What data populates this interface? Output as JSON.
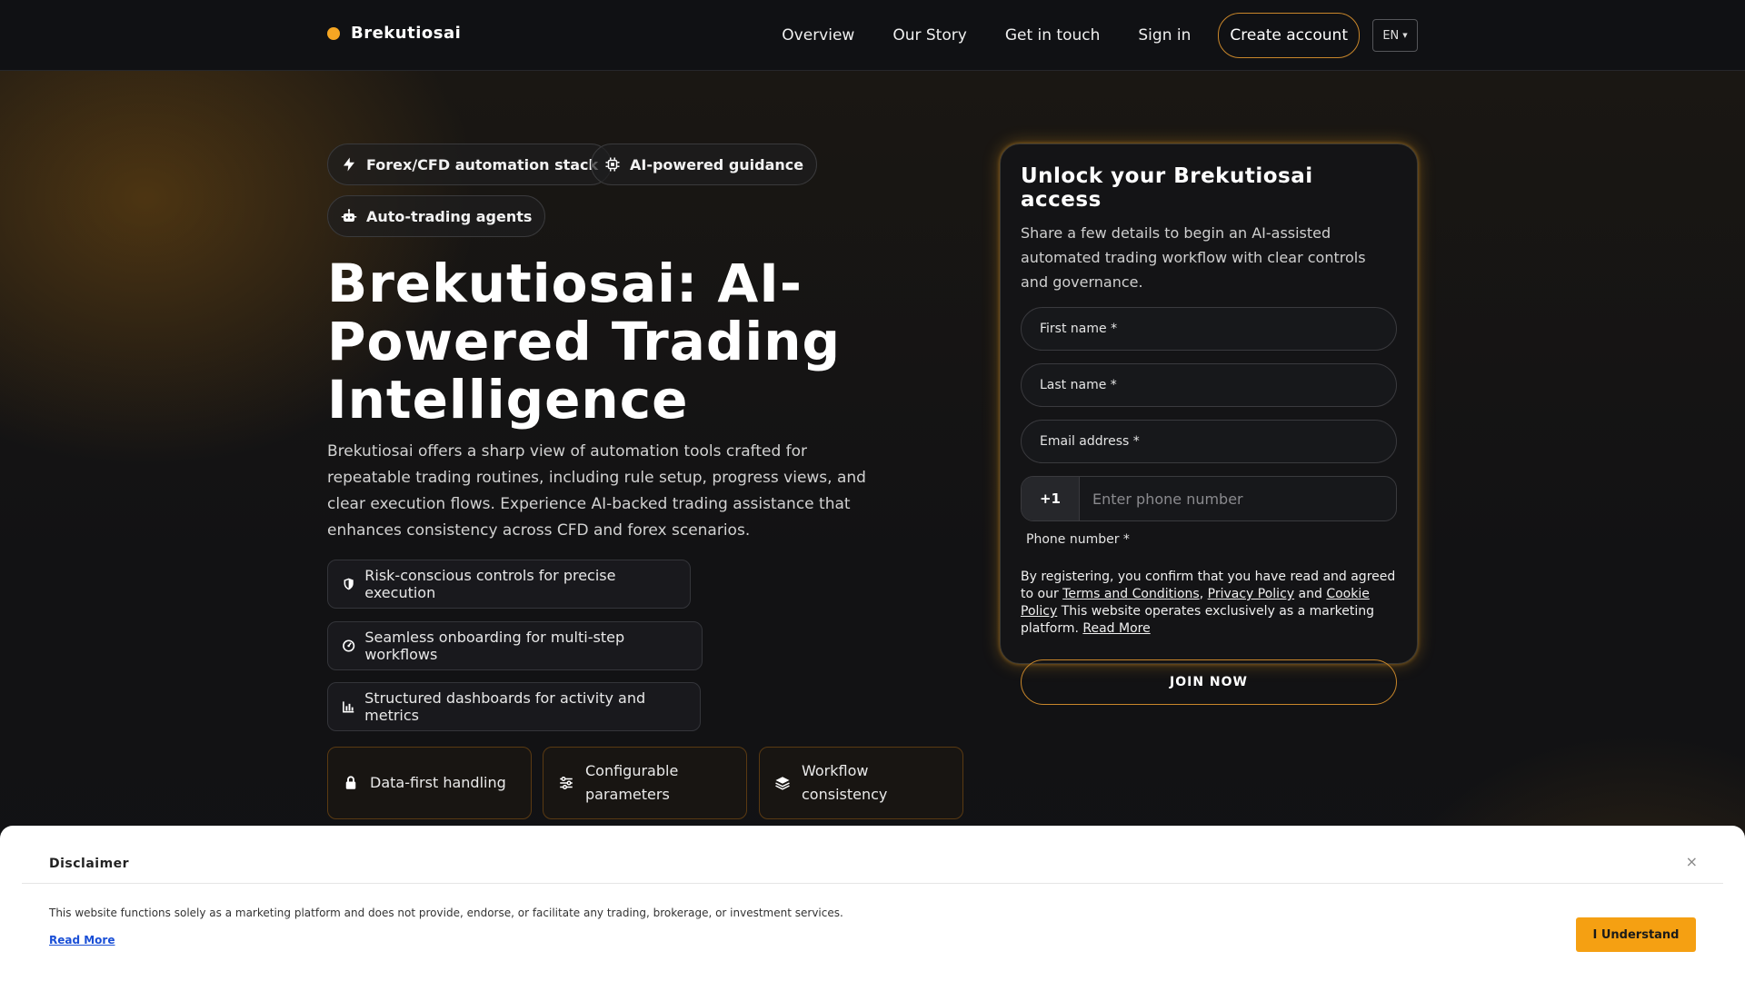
{
  "header": {
    "brand": "Brekutiosai",
    "nav": [
      "Overview",
      "Our Story",
      "Get in touch",
      "Sign in"
    ],
    "create_account": "Create account",
    "language": "EN"
  },
  "badges": [
    "Forex/CFD automation stack",
    "AI-powered guidance",
    "Auto-trading agents"
  ],
  "hero": {
    "title": "Brekutiosai: AI-Powered Trading Intelligence",
    "description": "Brekutiosai offers a sharp view of automation tools crafted for repeatable trading routines, including rule setup, progress views, and clear execution flows. Experience AI-backed trading assistance that enhances consistency across CFD and forex scenarios."
  },
  "features": [
    "Risk-conscious controls for precise execution",
    "Seamless onboarding for multi-step workflows",
    "Structured dashboards for activity and metrics"
  ],
  "cards": [
    "Data-first handling",
    "Configurable parameters",
    "Workflow consistency"
  ],
  "form": {
    "title": "Unlock your Brekutiosai access",
    "subtitle": "Share a few details to begin an AI-assisted automated trading workflow with clear controls and governance.",
    "first_name": "First name *",
    "last_name": "Last name *",
    "email": "Email address *",
    "country_code": "+1",
    "phone_placeholder": "Enter phone number",
    "phone_label": "Phone number *",
    "legal_prefix": "By registering, you confirm that you have read and agreed to our",
    "terms": "Terms and Conditions",
    "privacy": "Privacy Policy",
    "and": "and",
    "cookie": "Cookie Policy",
    "legal_suffix": "This website operates exclusively as a marketing platform.",
    "read_more": "Read More",
    "submit": "JOIN NOW"
  },
  "disclaimer": {
    "title": "Disclaimer",
    "close": "×",
    "text": "This website functions solely as a marketing platform and does not provide, endorse, or facilitate any trading, brokerage, or investment services.",
    "read_more": "Read More",
    "button": "I Understand"
  }
}
